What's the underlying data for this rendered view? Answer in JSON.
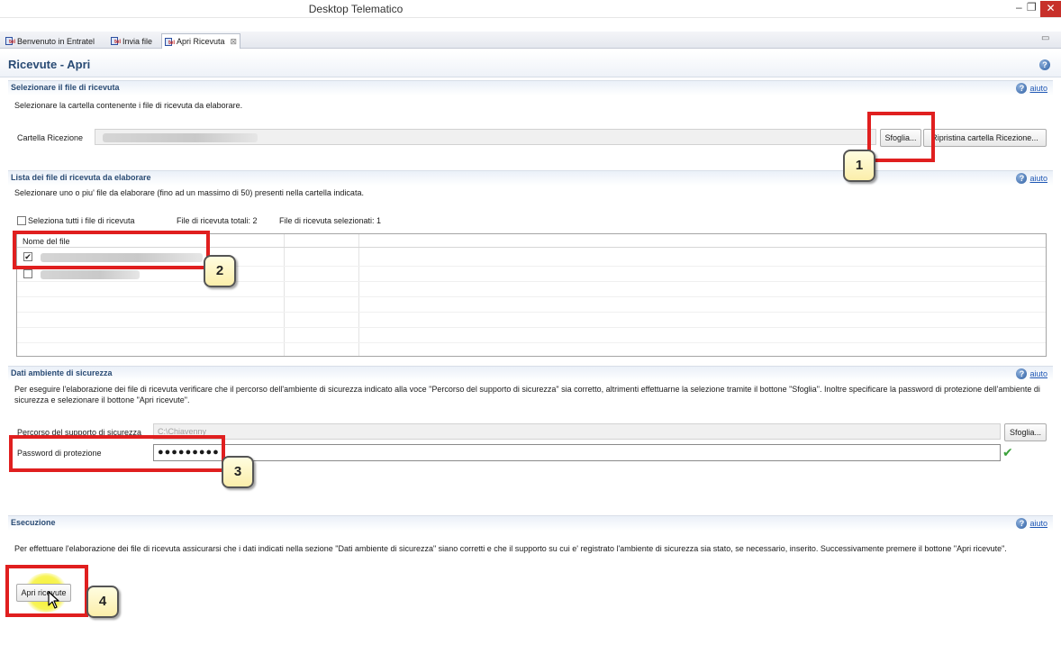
{
  "window": {
    "title": "Desktop Telematico",
    "min_glyph": "–",
    "max_glyph": "❐",
    "close_glyph": "✕"
  },
  "tabs": [
    {
      "label": "Benvenuto in Entratel",
      "active": false
    },
    {
      "label": "Invia file",
      "active": false
    },
    {
      "label": "Apri Ricevuta",
      "active": true
    }
  ],
  "page": {
    "title": "Ricevute - Apri"
  },
  "help_label": "aiuto",
  "section_file": {
    "title": "Selezionare il file di ricevuta",
    "description": "Selezionare la cartella contenente i file di ricevuta da elaborare.",
    "folder_label": "Cartella Ricezione",
    "browse_button": "Sfoglia...",
    "reset_button": "Ripristina cartella Ricezione..."
  },
  "section_list": {
    "title": "Lista dei file di ricevuta da elaborare",
    "description": "Selezionare uno o piu' file da elaborare (fino ad un massimo di 50) presenti nella cartella indicata.",
    "select_all_label": "Seleziona tutti i file di ricevuta",
    "total_label": "File di ricevuta totali: 2",
    "selected_label": "File di ricevuta selezionati: 1",
    "column_header": "Nome del file",
    "rows": [
      {
        "checked": true
      },
      {
        "checked": false
      }
    ]
  },
  "section_security": {
    "title": "Dati ambiente di sicurezza",
    "description": "Per eseguire l'elaborazione dei file di ricevuta verificare che il percorso dell'ambiente di sicurezza indicato alla voce \"Percorso del supporto di sicurezza\" sia corretto, altrimenti effettuarne la selezione tramite il bottone \"Sfoglia\". Inoltre specificare la password di protezione dell'ambiente di sicurezza e selezionare il bottone \"Apri ricevute\".",
    "path_label": "Percorso del supporto di sicurezza",
    "path_value": "C:\\Chiavenny",
    "browse_button": "Sfoglia...",
    "password_label": "Password di protezione",
    "password_mask": "●●●●●●●●●"
  },
  "section_exec": {
    "title": "Esecuzione",
    "description": "Per effettuare l'elaborazione dei file di ricevuta assicurarsi che i dati indicati nella sezione \"Dati ambiente di sicurezza\" siano corretti e che il supporto su cui e' registrato l'ambiente di sicurezza sia stato, se necessario, inserito. Successivamente premere il bottone \"Apri ricevute\".",
    "open_button": "Apri ricevute"
  },
  "annotations": [
    "1",
    "2",
    "3",
    "4"
  ],
  "colors": {
    "section_title": "#294b74",
    "highlight": "#e01f1f",
    "callout_bg": "#fbeeaa",
    "cursor_glow": "#f5f01e",
    "valid_check": "#3aa13a"
  }
}
